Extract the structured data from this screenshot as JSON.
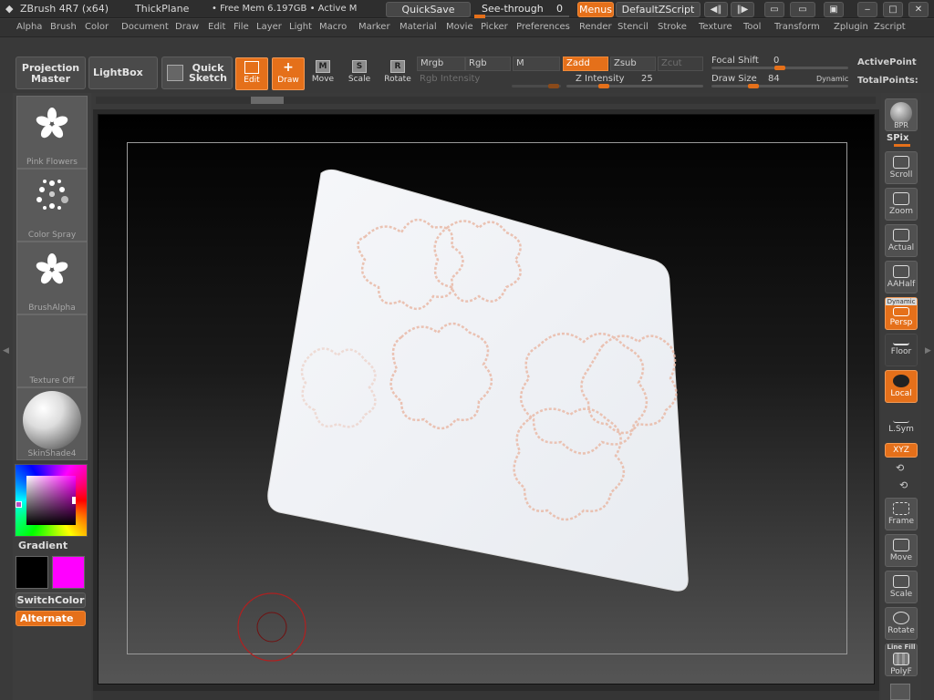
{
  "titlebar": {
    "app": "ZBrush 4R7 (x64)",
    "doc": "ThickPlane",
    "mem": "• Free Mem 6.197GB • Active M",
    "quicksave": "QuickSave",
    "seethrough": "See-through",
    "seethrough_value": "0",
    "menus": "Menus",
    "script": "DefaultZScript",
    "win_buttons": [
      "◀‖",
      "‖▶",
      "▭",
      "▭",
      "▣",
      "‒",
      "□",
      "✕"
    ]
  },
  "menubar": [
    "Alpha",
    "Brush",
    "Color",
    "Document",
    "Draw",
    "Edit",
    "File",
    "Layer",
    "Light",
    "Macro",
    "Marker",
    "Material",
    "Movie",
    "Picker",
    "Preferences",
    "Render",
    "Stencil",
    "Stroke",
    "Texture",
    "Tool",
    "Transform",
    "Zplugin",
    "Zscript"
  ],
  "toolbar": {
    "projection_master": "Projection Master",
    "lightbox": "LightBox",
    "quick_sketch": "Quick Sketch",
    "edit": "Edit",
    "draw": "Draw",
    "move": "Move",
    "scale": "Scale",
    "rotate": "Rotate",
    "move_key": "M",
    "scale_key": "S",
    "rotate_key": "R",
    "mrgb": "Mrgb",
    "rgb": "Rgb",
    "m": "M",
    "rgb_intensity": "Rgb Intensity",
    "zadd": "Zadd",
    "zsub": "Zsub",
    "zcut": "Zcut",
    "z_intensity": "Z Intensity",
    "z_intensity_value": "25",
    "z_intensity_level": 0.25,
    "focal_shift": "Focal Shift",
    "focal_shift_value": "0",
    "focal_shift_level": 0.5,
    "draw_size": "Draw Size",
    "draw_size_value": "84",
    "dynamic": "Dynamic",
    "active_points": "ActivePoint",
    "total_points": "TotalPoints:"
  },
  "left": {
    "brush": "Pink Flowers",
    "stroke": "Color Spray",
    "alpha": "BrushAlpha",
    "texture": "Texture Off",
    "material": "SkinShade4",
    "gradient": "Gradient",
    "switch_color": "SwitchColor",
    "alternate": "Alternate",
    "main_color": "#000000",
    "secondary_color": "#ff00ff"
  },
  "right": {
    "bpr": "BPR",
    "spix": "SPix",
    "buttons": [
      "Scroll",
      "Zoom",
      "Actual",
      "AAHalf",
      "Persp",
      "Floor",
      "Local",
      "L.Sym",
      "XYZ",
      "Frame",
      "Move",
      "Scale",
      "Rotate",
      "PolyF"
    ],
    "persp_tag": "Dynamic",
    "polyf_tag": "Line Fill"
  },
  "colors": {
    "accent": "#e5701a",
    "panel": "#3a3a3a"
  }
}
